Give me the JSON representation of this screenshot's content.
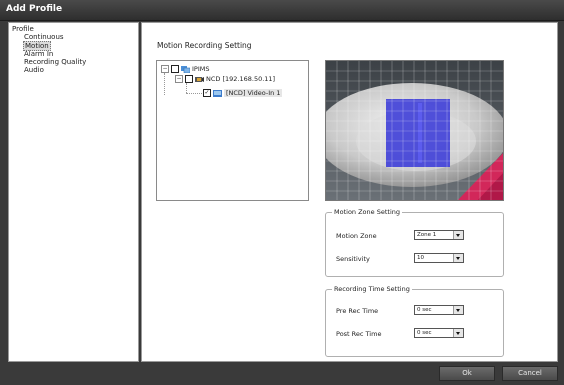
{
  "window": {
    "title": "Add Profile"
  },
  "profile_tree": {
    "root": "Profile",
    "items": [
      {
        "label": "Continuous",
        "selected": false
      },
      {
        "label": "Motion",
        "selected": true
      },
      {
        "label": "Alarm In",
        "selected": false
      },
      {
        "label": "Recording Quality",
        "selected": false
      },
      {
        "label": "Audio",
        "selected": false
      }
    ]
  },
  "motion_recording": {
    "title": "Motion Recording Setting",
    "device_tree": {
      "root": {
        "label": "IPIMS",
        "checked": false,
        "expanded": true
      },
      "device": {
        "label": "NCD [192.168.50.11]",
        "checked": false,
        "expanded": true
      },
      "channel": {
        "label": "[NCD] Video-In 1",
        "checked": true,
        "selected": true
      }
    },
    "motion_zone_setting": {
      "title": "Motion Zone Setting",
      "zone_label": "Motion Zone",
      "zone_value": "Zone 1",
      "sensitivity_label": "Sensitivity",
      "sensitivity_value": "10"
    },
    "recording_time_setting": {
      "title": "Recording Time Setting",
      "pre_label": "Pre Rec Time",
      "pre_value": "0 sec",
      "post_label": "Post Rec Time",
      "post_value": "0 sec"
    }
  },
  "footer": {
    "ok_label": "Ok",
    "cancel_label": "Cancel"
  },
  "colors": {
    "motion_zone": "#3f3fd8",
    "window_frame": "#3a3a3a",
    "panel": "#ffffff"
  }
}
